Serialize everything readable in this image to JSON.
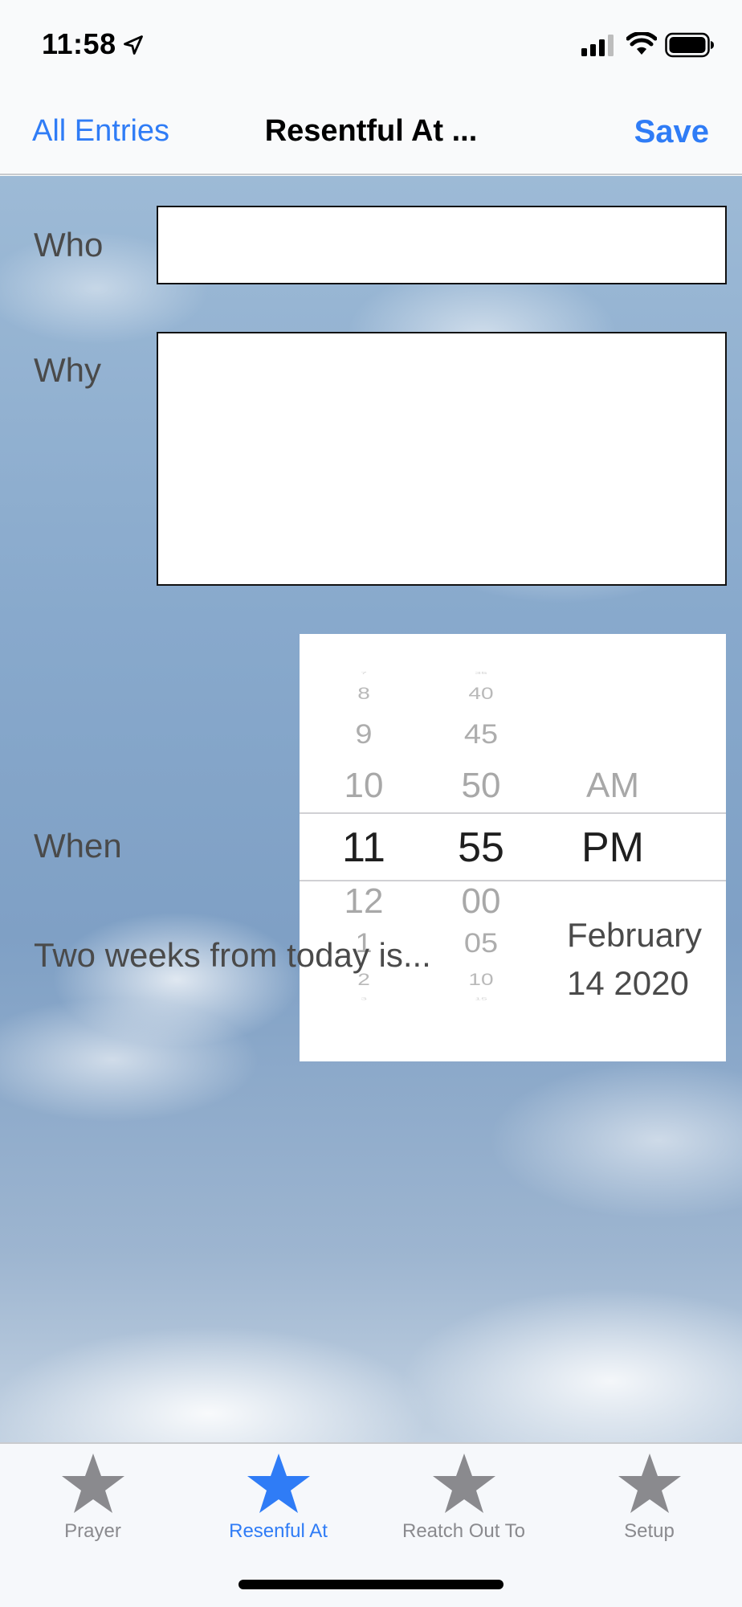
{
  "status_bar": {
    "time": "11:58"
  },
  "nav": {
    "back_label": "All Entries",
    "title": "Resentful At ...",
    "save_label": "Save"
  },
  "form": {
    "who_label": "Who",
    "who_value": "",
    "why_label": "Why",
    "why_value": "",
    "when_label": "When"
  },
  "time_picker": {
    "hours": [
      "7",
      "8",
      "9",
      "10",
      "11",
      "12",
      "1",
      "2",
      "3"
    ],
    "minutes": [
      "35",
      "40",
      "45",
      "50",
      "55",
      "00",
      "05",
      "10",
      "15"
    ],
    "ampm_above": "AM",
    "selected_hour": "11",
    "selected_minute": "55",
    "selected_ampm": "PM"
  },
  "reminder": {
    "label": "Two weeks from today is...",
    "date_line1": "February",
    "date_line2": "14 2020"
  },
  "tabs": [
    {
      "label": "Prayer",
      "icon": "star-icon",
      "active": false
    },
    {
      "label": "Resenful At",
      "icon": "star-icon",
      "active": true
    },
    {
      "label": "Reatch Out To",
      "icon": "star-icon",
      "active": false
    },
    {
      "label": "Setup",
      "icon": "star-icon",
      "active": false
    }
  ],
  "colors": {
    "accent": "#2f7cf6",
    "tab_inactive": "#8a8a8e"
  }
}
